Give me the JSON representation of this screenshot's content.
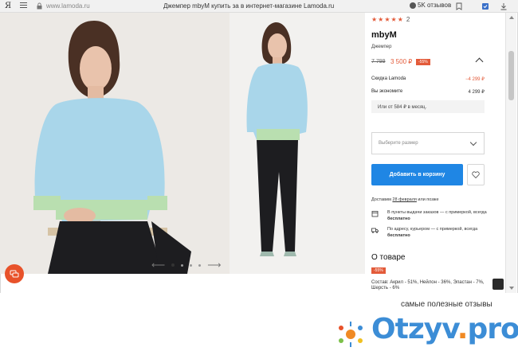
{
  "browser": {
    "logo_letter": "Я",
    "url": "www.lamoda.ru",
    "page_title": "Джемпер mbyM купить за в интернет-магазине Lamoda.ru",
    "reviews_label": "5K отзывов"
  },
  "product": {
    "rating_stars": "★★★★★",
    "review_count": "2",
    "brand": "mbyM",
    "type": "Джемпер",
    "old_price": "7 799",
    "new_price": "3 500 ₽",
    "discount_badge": "-55%",
    "discount_label": "Скидка Lamoda",
    "discount_value": "−4 299 ₽",
    "savings_label": "Вы экономите",
    "savings_value": "4 299 ₽",
    "installment": "Или от 584 ₽ в месяц.",
    "size_placeholder": "Выберите размер",
    "add_to_cart": "Добавить в корзину",
    "delivery_prefix": "Доставим",
    "delivery_date": "28 февраля",
    "delivery_suffix": "или позже",
    "pickup_text_1": "В пункты выдачи заказов — с примеркой, всегда",
    "pickup_bold": "бесплатно",
    "courier_text_1": "По адресу, курьером — с примеркой, всегда",
    "courier_bold": "бесплатно",
    "about_title": "О товаре",
    "about_badge": "-55%",
    "composition": "Состав: Акрил - 51%, Нейлон - 36%, Эластан - 7%, Шерсть - 6%"
  },
  "colors": {
    "accent": "#e35b3a",
    "button": "#1f86e4",
    "sweater": "#a9d6ea",
    "cuff": "#b9dfb0"
  },
  "watermark": {
    "slogan": "самые полезные отзывы",
    "logo_main": "Otzyv",
    "logo_dot": ".",
    "logo_tail": "pro"
  }
}
